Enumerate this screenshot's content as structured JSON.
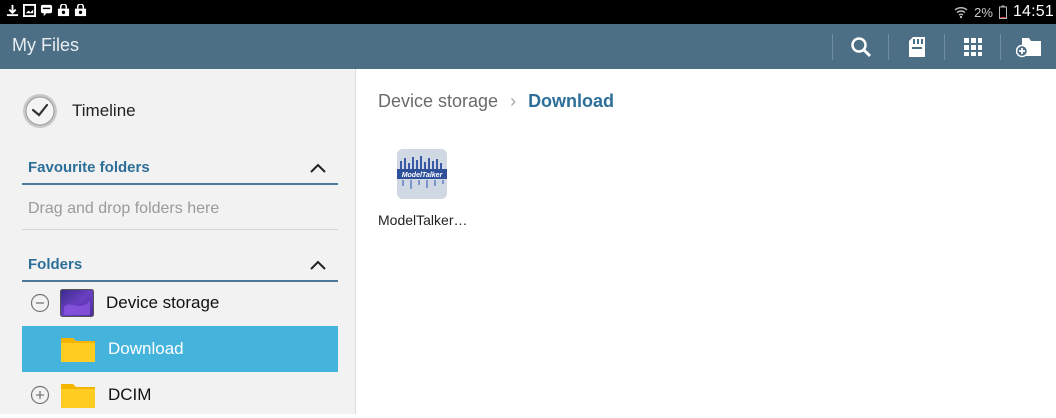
{
  "status_bar": {
    "left_icons": [
      "download-icon",
      "image-icon",
      "message-icon",
      "shopping-bag-icon",
      "shopping-bag-icon"
    ],
    "wifi": "wifi-icon",
    "battery_percent": "2%",
    "time": "14:51"
  },
  "action_bar": {
    "title": "My Files",
    "actions": [
      "search-icon",
      "sd-card-icon",
      "grid-view-icon",
      "new-folder-icon"
    ],
    "bar_color": "#4d6f85"
  },
  "sidebar": {
    "timeline_label": "Timeline",
    "favourites": {
      "header": "Favourite folders",
      "placeholder": "Drag and drop folders here"
    },
    "folders": {
      "header": "Folders",
      "items": [
        {
          "label": "Device storage",
          "toggle": "collapse",
          "selected": false
        },
        {
          "label": "Download",
          "toggle": "none",
          "selected": true
        },
        {
          "label": "DCIM",
          "toggle": "expand",
          "selected": false
        }
      ]
    },
    "accent_color": "#2d6f99",
    "selected_color": "#45b4dc"
  },
  "main": {
    "breadcrumb": [
      "Device storage",
      "Download"
    ],
    "files": [
      {
        "name": "ModelTalker…",
        "thumb_text": "ModelTalker"
      }
    ]
  }
}
